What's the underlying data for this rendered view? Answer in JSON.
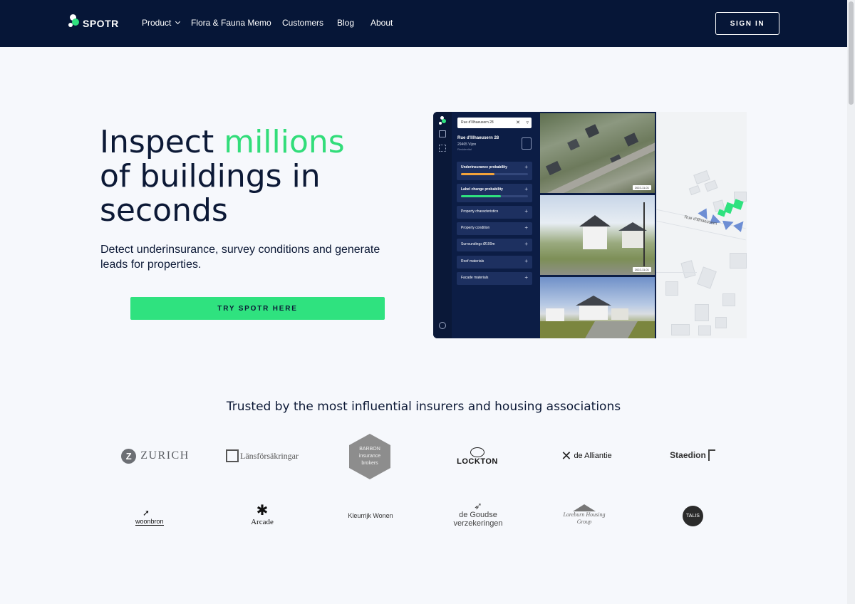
{
  "nav": {
    "brand": "SPOTR",
    "links": [
      "Product",
      "Flora & Fauna Memo",
      "Customers",
      "Blog",
      "About"
    ],
    "signin": "SIGN IN"
  },
  "hero": {
    "title_line1_a": "Inspect ",
    "title_line1_b": "millions",
    "title_line2": "of buildings in",
    "title_line3": "seconds",
    "subtitle": "Detect underinsurance, survey conditions and generate leads for properties.",
    "cta": "TRY SPOTR HERE",
    "accent_color": "#32dd7a",
    "cta_color": "#2fe27f"
  },
  "app": {
    "search_value": "Rue d'Illhaeusern 28",
    "address": "Rue d'Illhaeusern 28",
    "postcode": "29465 Vijon",
    "type": "Residential",
    "cards": [
      {
        "label": "Underinsurance probability",
        "progress": 0.5,
        "color": "#f3a33a"
      },
      {
        "label": "Label change probability",
        "progress": 0.6,
        "color": "#2fe27f"
      },
      {
        "label": "Property characteristics"
      },
      {
        "label": "Property condition"
      },
      {
        "label": "Surroundings Ø100m"
      },
      {
        "label": "Roof materials"
      },
      {
        "label": "Facade materials"
      }
    ],
    "photo_date_1": "2022-11-01",
    "photo_date_2": "2022-11-01",
    "street_label": "Rue d'Illhaeusern"
  },
  "trusted": {
    "heading": "Trusted by the most influential insurers and housing associations",
    "row1": [
      "ZURICH",
      "Länsförsäkringar",
      "BARBON insurance brokers",
      "LOCKTON",
      "de Alliantie",
      "Staedion"
    ],
    "row2": [
      "woonbron",
      "Arcade",
      "Kleurrijk Wonen",
      "de Goudse verzekeringen",
      "Loreburn Housing Group",
      "TALIS"
    ]
  }
}
